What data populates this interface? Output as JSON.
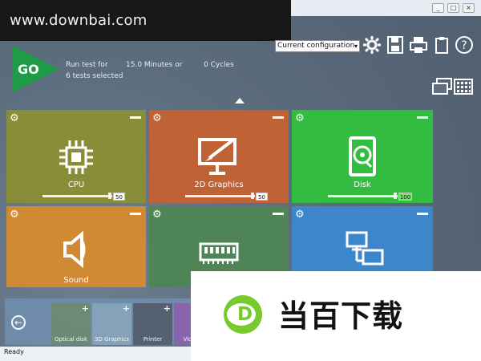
{
  "watermark": {
    "text": "www.downbai.com"
  },
  "window": {
    "controls": [
      "minimize",
      "restore",
      "close"
    ],
    "status": "Ready"
  },
  "toolbar": {
    "go_label": "GO",
    "run_label": "Run test for",
    "duration": "15.0 Minutes or",
    "cycles": "0 Cycles",
    "selected": "6 tests selected",
    "config": "Current configuration",
    "icons": [
      "gear-icon",
      "save-icon",
      "printer-icon",
      "clipboard-icon",
      "help-icon",
      "windows-icon",
      "grid-icon"
    ]
  },
  "tiles": [
    {
      "label": "CPU",
      "value": "50",
      "color": "#8a8d37"
    },
    {
      "label": "2D Graphics",
      "value": "50",
      "color": "#bf6337"
    },
    {
      "label": "Disk",
      "value": "100",
      "color": "#32bd41"
    },
    {
      "label": "Sound",
      "value": "",
      "color": "#d18a34"
    },
    {
      "label": "",
      "value": "",
      "color": "#4f8556"
    },
    {
      "label": "",
      "value": "",
      "color": "#3d86cc"
    }
  ],
  "bottom": {
    "items": [
      {
        "label": "Optical disk"
      },
      {
        "label": "3D Graphics"
      },
      {
        "label": "Printer"
      },
      {
        "label": "Video P"
      }
    ]
  },
  "ad": {
    "text": "当百下载"
  }
}
